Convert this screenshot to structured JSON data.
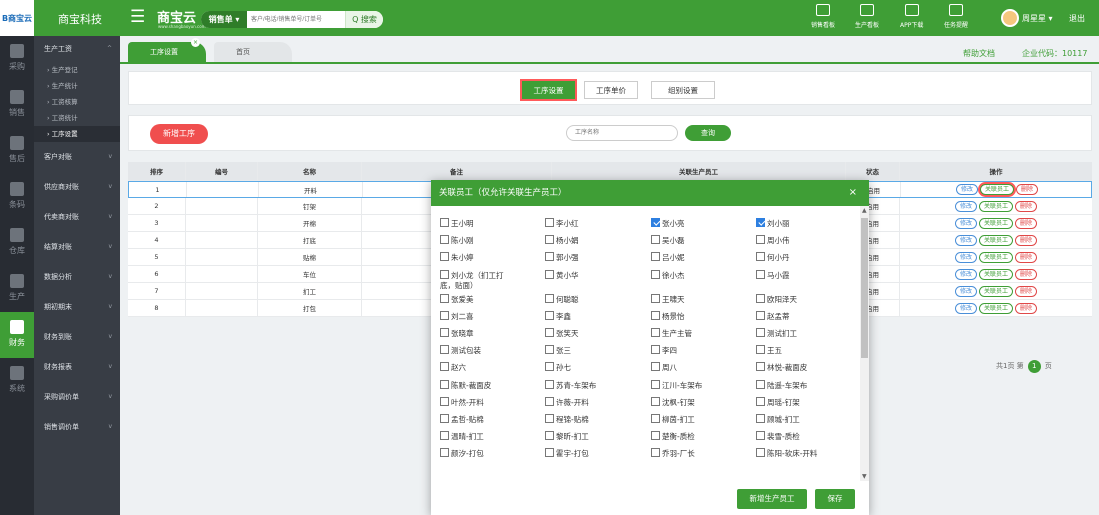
{
  "logo": {
    "text": "B商宝云"
  },
  "header": {
    "company": "商宝科技",
    "brand": "商宝云",
    "brand_sub": "www.shangbaoyun.com",
    "search_type": "销售单 ▾",
    "search_placeholder": "客户/电话/销售单号/订单号",
    "search_button": "Q 搜索",
    "icons": [
      {
        "label": "销售看板",
        "icon": "sales-board-icon"
      },
      {
        "label": "生产看板",
        "icon": "production-board-icon"
      },
      {
        "label": "APP下载",
        "icon": "qr-code-icon"
      },
      {
        "label": "任务提醒",
        "icon": "flag-icon"
      }
    ],
    "user": "周星星 ▾",
    "logout": "退出"
  },
  "rail": [
    {
      "label": "采购",
      "icon": "cart-icon",
      "active": false
    },
    {
      "label": "销售",
      "icon": "sales-icon",
      "active": false
    },
    {
      "label": "售后",
      "icon": "after-sales-icon",
      "active": false
    },
    {
      "label": "条码",
      "icon": "barcode-icon",
      "active": false
    },
    {
      "label": "仓库",
      "icon": "warehouse-icon",
      "active": false
    },
    {
      "label": "生产",
      "icon": "production-icon",
      "active": false
    },
    {
      "label": "财务",
      "icon": "finance-icon",
      "active": true
    },
    {
      "label": "系统",
      "icon": "gear-icon",
      "active": false
    }
  ],
  "nav": {
    "group1": "生产工资",
    "subs": [
      "› 生产登记",
      "› 生产统计",
      "› 工资核算",
      "› 工资统计",
      "› 工序设置"
    ],
    "groups": [
      "客户对账",
      "供应商对账",
      "代卖商对账",
      "结算对账",
      "数据分析",
      "期初期末",
      "财务到账",
      "财务报表",
      "采购调价单",
      "销售调价单"
    ]
  },
  "tabs": {
    "active": "工序设置",
    "other": "首页",
    "close": "×"
  },
  "help": "帮助文档",
  "corp_code": "企业代码：10117",
  "segments": [
    "工序设置",
    "工序单价",
    "组别设置"
  ],
  "toolbar": {
    "add": "新增工序",
    "name_placeholder": "工序名称",
    "query": "查询"
  },
  "table": {
    "headers": [
      "排序",
      "编号",
      "名称",
      "备注",
      "关联生产员工",
      "状态",
      "操作"
    ],
    "rows": [
      {
        "sort": "1",
        "name": "开料",
        "status": "启用"
      },
      {
        "sort": "2",
        "name": "钉架",
        "status": "启用"
      },
      {
        "sort": "3",
        "name": "开棉",
        "status": "启用"
      },
      {
        "sort": "4",
        "name": "打底",
        "status": "启用"
      },
      {
        "sort": "5",
        "name": "贴棉",
        "status": "启用"
      },
      {
        "sort": "6",
        "name": "车位",
        "status": "启用"
      },
      {
        "sort": "7",
        "name": "扪工",
        "status": "启用"
      },
      {
        "sort": "8",
        "name": "打包",
        "status": "启用"
      }
    ],
    "ops": {
      "edit": "修改",
      "rel": "关联员工",
      "del": "删除"
    }
  },
  "pager": {
    "prefix": "共1页 第",
    "page": "1",
    "suffix": "页"
  },
  "modal": {
    "title": "关联员工（仅允许关联生产员工）",
    "close": "×",
    "employees": [
      {
        "name": "王小明",
        "checked": false
      },
      {
        "name": "李小红",
        "checked": false
      },
      {
        "name": "张小亮",
        "checked": true
      },
      {
        "name": "刘小丽",
        "checked": true
      },
      {
        "name": "陈小刚",
        "checked": false
      },
      {
        "name": "杨小娟",
        "checked": false
      },
      {
        "name": "吴小磊",
        "checked": false
      },
      {
        "name": "周小伟",
        "checked": false
      },
      {
        "name": "朱小婷",
        "checked": false
      },
      {
        "name": "郭小强",
        "checked": false
      },
      {
        "name": "吕小妮",
        "checked": false
      },
      {
        "name": "何小丹",
        "checked": false
      },
      {
        "name": "刘小龙（扪工打",
        "name2": "底，贴面）",
        "checked": false
      },
      {
        "name": "黄小华",
        "checked": false
      },
      {
        "name": "徐小杰",
        "checked": false
      },
      {
        "name": "马小霞",
        "checked": false
      },
      {
        "name": "张爱美",
        "checked": false
      },
      {
        "name": "何聪聪",
        "checked": false
      },
      {
        "name": "王啸天",
        "checked": false
      },
      {
        "name": "欧阳泽天",
        "checked": false
      },
      {
        "name": "刘二喜",
        "checked": false
      },
      {
        "name": "李鑫",
        "checked": false
      },
      {
        "name": "杨景怡",
        "checked": false
      },
      {
        "name": "赵孟蒂",
        "checked": false
      },
      {
        "name": "张晓章",
        "checked": false
      },
      {
        "name": "张笑天",
        "checked": false
      },
      {
        "name": "生产主管",
        "checked": false
      },
      {
        "name": "测试扪工",
        "checked": false
      },
      {
        "name": "测试包装",
        "checked": false
      },
      {
        "name": "张三",
        "checked": false
      },
      {
        "name": "李四",
        "checked": false
      },
      {
        "name": "王五",
        "checked": false
      },
      {
        "name": "赵六",
        "checked": false
      },
      {
        "name": "孙七",
        "checked": false
      },
      {
        "name": "周八",
        "checked": false
      },
      {
        "name": "林悦-裁面皮",
        "checked": false
      },
      {
        "name": "陈默-裁面皮",
        "checked": false
      },
      {
        "name": "苏青-车架布",
        "checked": false
      },
      {
        "name": "江川-车架布",
        "checked": false
      },
      {
        "name": "陆遥-车架布",
        "checked": false
      },
      {
        "name": "叶然-开料",
        "checked": false
      },
      {
        "name": "许薇-开料",
        "checked": false
      },
      {
        "name": "沈枫-钉架",
        "checked": false
      },
      {
        "name": "周瑶-钉架",
        "checked": false
      },
      {
        "name": "孟哲-贴棉",
        "checked": false
      },
      {
        "name": "程锦-贴棉",
        "checked": false
      },
      {
        "name": "柳茵-扪工",
        "checked": false
      },
      {
        "name": "顾城-扪工",
        "checked": false
      },
      {
        "name": "温晴-扪工",
        "checked": false
      },
      {
        "name": "黎昕-扪工",
        "checked": false
      },
      {
        "name": "楚衡-质检",
        "checked": false
      },
      {
        "name": "裴雪-质检",
        "checked": false
      },
      {
        "name": "颜汐-打包",
        "checked": false
      },
      {
        "name": "霍宇-打包",
        "checked": false
      },
      {
        "name": "乔羽-厂长",
        "checked": false
      },
      {
        "name": "陈阳-软床-开料",
        "checked": false
      }
    ],
    "add_btn": "新增生产员工",
    "save_btn": "保存"
  }
}
